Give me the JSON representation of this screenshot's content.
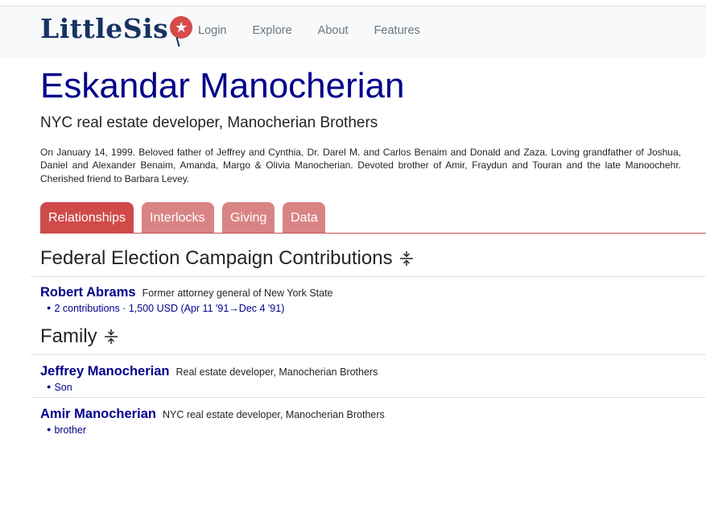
{
  "nav": {
    "logo_text": "LittleSis",
    "links": [
      "Login",
      "Explore",
      "About",
      "Features"
    ]
  },
  "entity": {
    "name": "Eskandar Manocherian",
    "blurb": "NYC real estate developer, Manocherian Brothers",
    "description": "On January 14, 1999. Beloved father of Jeffrey and Cynthia, Dr. Darel M. and Carlos Benaim and Donald and Zaza. Loving grandfather of Joshua, Daniel and Alexander Benaim, Amanda, Margo & Olivia Manocherian. Devoted brother of Amir, Fraydun and Touran and the late Manoochehr. Cherished friend to Barbara Levey."
  },
  "tabs": [
    "Relationships",
    "Interlocks",
    "Giving",
    "Data"
  ],
  "sections": [
    {
      "title": "Federal Election Campaign Contributions",
      "items": [
        {
          "name": "Robert Abrams",
          "blurb": "Former attorney general of New York State",
          "detail": "2 contributions · 1,500 USD (Apr 11 '91→Dec 4 '91)"
        }
      ]
    },
    {
      "title": "Family",
      "items": [
        {
          "name": "Jeffrey Manocherian",
          "blurb": "Real estate developer, Manocherian Brothers",
          "detail": "Son"
        },
        {
          "name": "Amir Manocherian",
          "blurb": "NYC real estate developer, Manocherian Brothers",
          "detail": "brother"
        }
      ]
    }
  ],
  "colors": {
    "title_blue": "#00008b",
    "tab_active": "#d04a4a",
    "tab_inactive": "#d98484",
    "logo_navy": "#183363",
    "logo_red": "#d64a4a"
  }
}
